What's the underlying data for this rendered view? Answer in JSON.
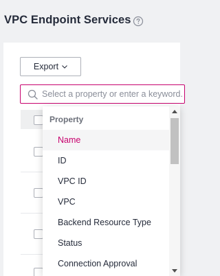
{
  "page": {
    "title": "VPC Endpoint Services",
    "help_icon": "question-circle-icon"
  },
  "toolbar": {
    "export_label": "Export",
    "export_icon": "chevron-down-icon"
  },
  "search": {
    "placeholder": "Select a property or enter a keyword.",
    "value": "",
    "icon": "search-icon"
  },
  "dropdown": {
    "group_label": "Property",
    "items": [
      {
        "label": "Name",
        "selected": true
      },
      {
        "label": "ID",
        "selected": false
      },
      {
        "label": "VPC ID",
        "selected": false
      },
      {
        "label": "VPC",
        "selected": false
      },
      {
        "label": "Backend Resource Type",
        "selected": false
      },
      {
        "label": "Status",
        "selected": false
      },
      {
        "label": "Connection Approval",
        "selected": false
      }
    ]
  },
  "colors": {
    "accent": "#c7006d",
    "text": "#252b3a",
    "muted": "#8a8e99",
    "background": "#f0f1f3"
  }
}
